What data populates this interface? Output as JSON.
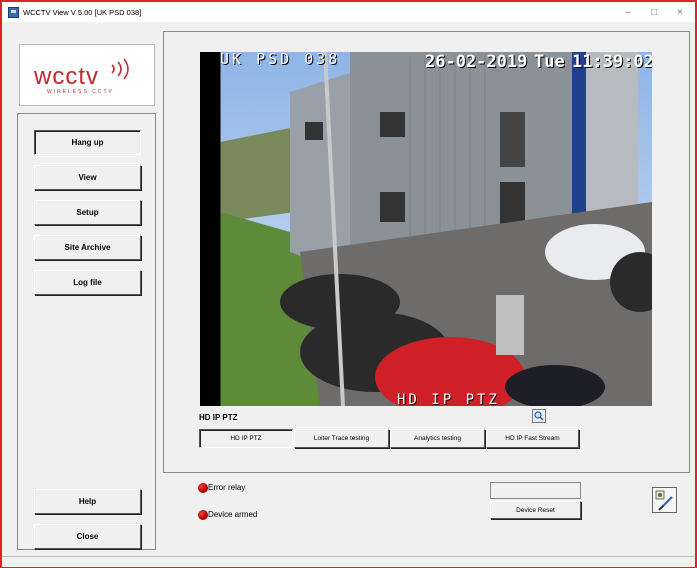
{
  "window": {
    "title": "WCCTV View  V 5.00  [UK PSD 038]",
    "controls": {
      "minimize": "–",
      "maximize": "□",
      "close": "×"
    }
  },
  "logo": {
    "text": "wcctv",
    "tagline": "WIRELESS CCTV"
  },
  "left_menu": {
    "hang_up": "Hang up",
    "view": "View",
    "setup": "Setup",
    "site_archive": "Site Archive",
    "log_file": "Log file",
    "help": "Help",
    "close": "Close"
  },
  "video": {
    "site_overlay": "UK PSD 038",
    "date_overlay": "26-02-2019",
    "day_overlay": "Tue",
    "time_overlay": "11:39:02",
    "camera_overlay": "HD IP PTZ"
  },
  "camera": {
    "current_label": "HD IP PTZ",
    "tabs": [
      "HD IP PTZ",
      "Loiter Trace testing",
      "Analytics testing",
      "HD IP Fast Stream"
    ]
  },
  "status": {
    "error_relay": "Error relay",
    "device_armed": "Device armed",
    "device_reset": "Device Reset"
  },
  "colors": {
    "led": "#cc1111",
    "brand": "#c2282d",
    "window_border": "#d9262a"
  }
}
